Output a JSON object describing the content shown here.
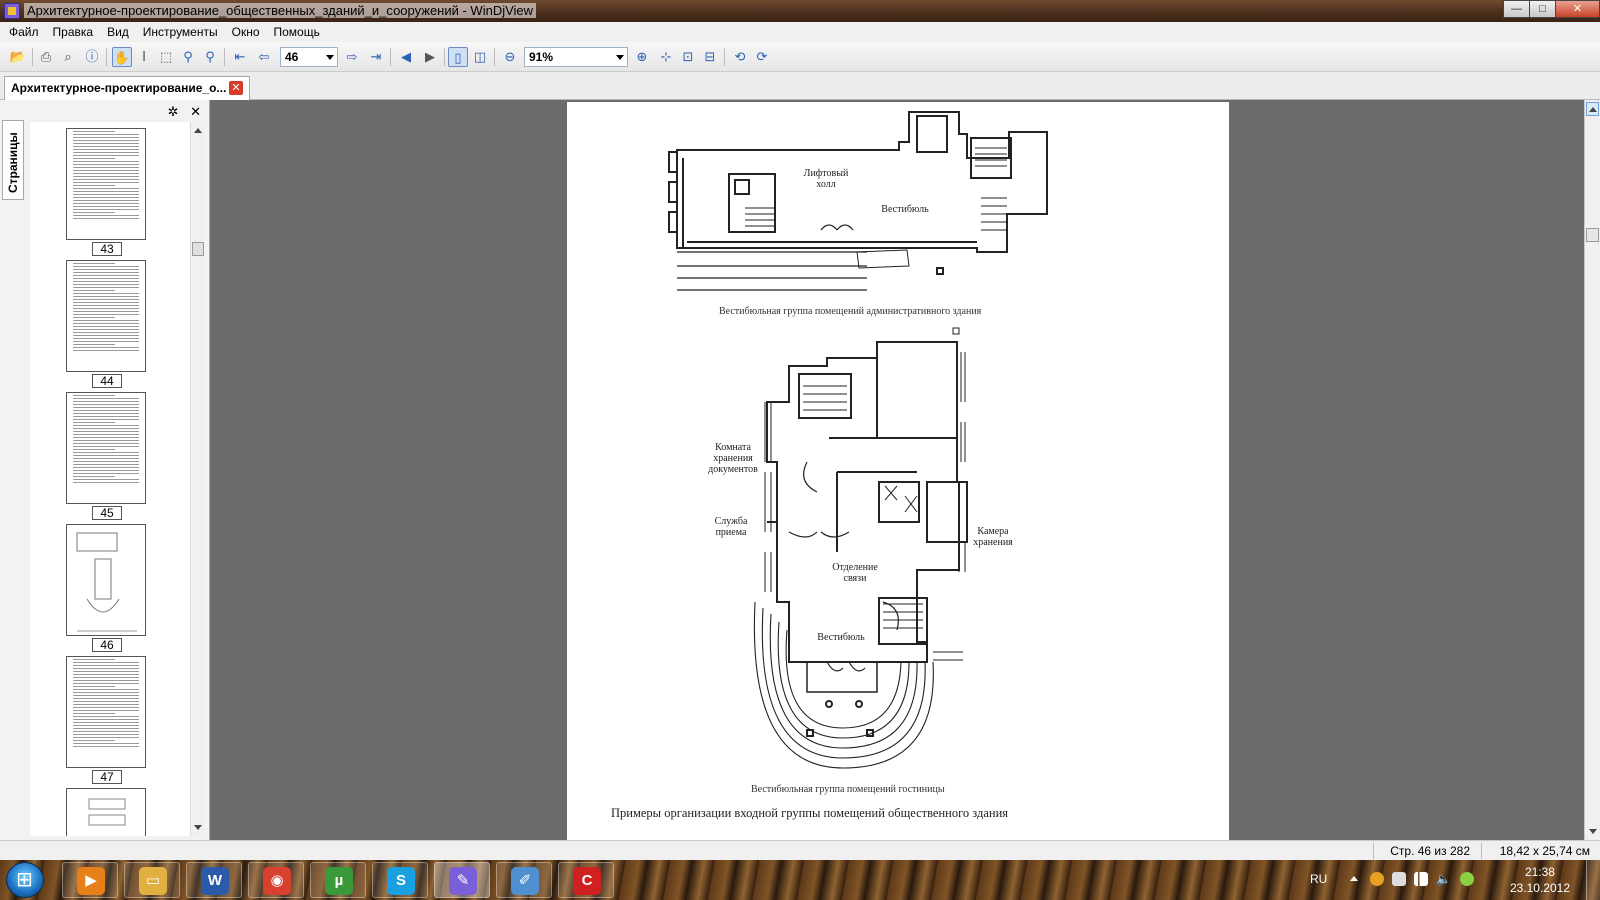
{
  "window": {
    "title": "Архитектурное-проектирование_общественных_зданий_и_сооружений - WinDjView",
    "buttons": {
      "minimize": "—",
      "maximize": "□",
      "close": "✕"
    }
  },
  "menu": [
    "Файл",
    "Правка",
    "Вид",
    "Инструменты",
    "Окно",
    "Помощь"
  ],
  "toolbar": {
    "page_number": "46",
    "zoom": "91%",
    "icons": [
      "open-icon",
      "print-icon",
      "find-icon",
      "info-icon",
      "hand-tool-icon",
      "text-select-icon",
      "rect-select-icon",
      "zoom-in-tool-icon",
      "zoom-out-tool-icon",
      "first-page-icon",
      "prev-page-icon",
      "next-page-icon",
      "last-page-icon",
      "back-icon",
      "forward-icon",
      "single-page-icon",
      "two-pages-icon",
      "zoom-out-icon",
      "zoom-in-icon",
      "fit-page-icon",
      "fit-width-icon",
      "actual-size-icon",
      "rotate-left-icon",
      "rotate-right-icon"
    ]
  },
  "tab": {
    "label": "Архитектурное-проектирование_о...",
    "close": "✕"
  },
  "sidebar": {
    "vertical_tab": "Страницы",
    "tools": {
      "settings": "✲",
      "close": "✕"
    },
    "thumbnails": [
      {
        "page": "43"
      },
      {
        "page": "44"
      },
      {
        "page": "45"
      },
      {
        "page": "46"
      },
      {
        "page": "47"
      }
    ]
  },
  "page": {
    "plan1_labels": {
      "lift_hall": "Лифтовый\nхолл",
      "vestibule": "Вестибюль"
    },
    "caption1": "Вестибюльная группа помещений административного здания",
    "plan2_labels": {
      "doc_storage": "Комната\nхранения\nдокументов",
      "reception": "Служба\nприема",
      "storage": "Камера\nхранения",
      "comm": "Отделение\nсвязи",
      "vestibule": "Вестибюль"
    },
    "caption2": "Вестибюльная группа помещений гостиницы",
    "heading": "Примеры организации входной группы помещений общественного здания"
  },
  "status": {
    "page_info": "Стр. 46 из 282",
    "page_size": "18,42 x 25,74 см"
  },
  "taskbar": {
    "lang": "RU",
    "time": "21:38",
    "date": "23.10.2012",
    "apps": [
      {
        "name": "media-player",
        "color": "#e8801a",
        "glyph": "▶"
      },
      {
        "name": "explorer",
        "color": "#e0b040",
        "glyph": "▭"
      },
      {
        "name": "word",
        "color": "#2a5aa8",
        "glyph": "W"
      },
      {
        "name": "chrome",
        "color": "#d84030",
        "glyph": "◉"
      },
      {
        "name": "utorrent",
        "color": "#3a9a3a",
        "glyph": "µ"
      },
      {
        "name": "skype",
        "color": "#1aa0e0",
        "glyph": "S"
      },
      {
        "name": "windjview",
        "color": "#7b5fd8",
        "glyph": "✎"
      },
      {
        "name": "paint",
        "color": "#5090d0",
        "glyph": "✐"
      },
      {
        "name": "red-app",
        "color": "#d02020",
        "glyph": "C"
      }
    ]
  }
}
